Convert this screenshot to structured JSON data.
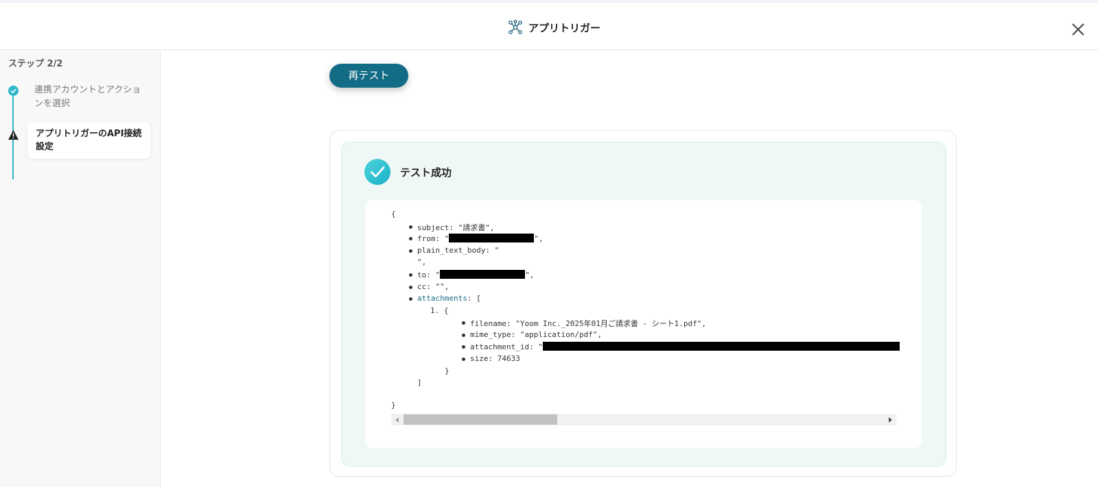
{
  "header": {
    "title": "アプリトリガー",
    "icon": "integration-network-icon",
    "close_icon": "close-icon"
  },
  "sidebar": {
    "step_label": "ステップ 2/2",
    "steps": [
      {
        "label": "連携アカウントとアクションを選択",
        "status": "completed"
      },
      {
        "label": "アプリトリガーのAPI接続設定",
        "status": "warning-current"
      }
    ]
  },
  "main": {
    "retest_label": "再テスト",
    "success_title": "テスト成功",
    "json": {
      "open_brace": "{",
      "subject_key": "subject",
      "subject_value": "\"請求書\",",
      "from_key": "from",
      "plain_text_body_key": "plain_text_body",
      "plain_text_body_value": "\"",
      "plain_text_body_end": "\",",
      "to_key": "to",
      "cc_key": "cc",
      "cc_value": "\"\",",
      "attachments_key": "attachments",
      "attachments_open": ": [",
      "index": "1.",
      "obj_open": "{",
      "filename_key": "filename",
      "filename_value": "\"Yoom Inc._2025年01月ご請求書 - シート1.pdf\",",
      "mime_type_key": "mime_type",
      "mime_type_value": "\"application/pdf\",",
      "attachment_id_key": "attachment_id",
      "size_key": "size",
      "size_value": "74633",
      "obj_close": "}",
      "array_close": "]",
      "close_brace": "}"
    }
  },
  "colors": {
    "accent": "#136c85",
    "step_teal": "#2fb7c8",
    "success_bg": "#f0f8f7"
  }
}
